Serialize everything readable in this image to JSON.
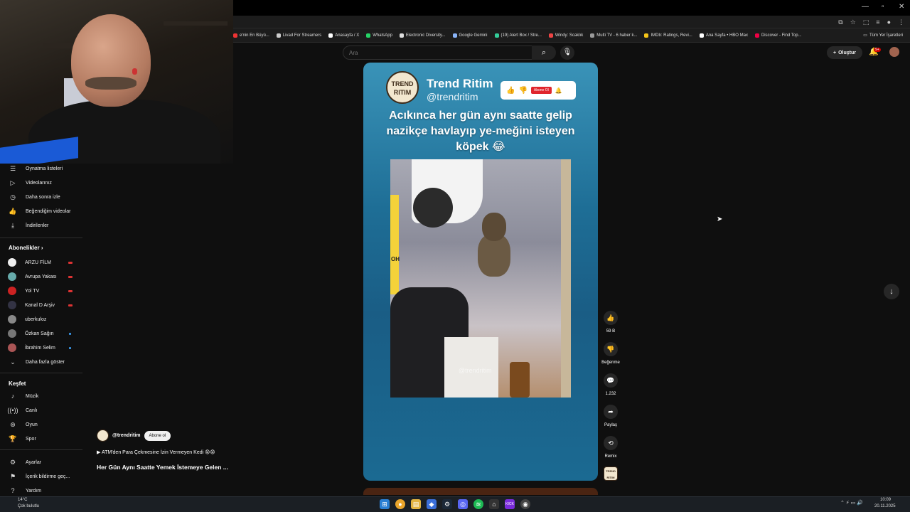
{
  "browser": {
    "bookmarks": [
      {
        "label": "e'nin En Büyü...",
        "color": "#e33"
      },
      {
        "label": "Livad For Streamers",
        "color": "#ccc"
      },
      {
        "label": "Anasayfa / X",
        "color": "#fff"
      },
      {
        "label": "WhatsApp",
        "color": "#25d366"
      },
      {
        "label": "Electronic Diversity...",
        "color": "#ddd"
      },
      {
        "label": "Google Gemini",
        "color": "#8ab4f8"
      },
      {
        "label": "(19) Alert Box / Stre...",
        "color": "#3c9"
      },
      {
        "label": "Windy: Scaklık",
        "color": "#e44"
      },
      {
        "label": "Multi TV - 6 haber k...",
        "color": "#999"
      },
      {
        "label": "IMDb: Ratings, Revi...",
        "color": "#f5c518"
      },
      {
        "label": "Ana Sayfa • HBO Max",
        "color": "#fff"
      },
      {
        "label": "Discover - Find Top...",
        "color": "#e04"
      }
    ],
    "all_bookmarks": "Tüm Yer İşaretleri"
  },
  "topbar": {
    "search_placeholder": "Ara",
    "create_label": "Oluştur",
    "notif_count": "9+"
  },
  "sidebar": {
    "items_top": [
      {
        "label": "Oynatma listeleri",
        "icon": "playlist-icon"
      },
      {
        "label": "Videolarınız",
        "icon": "video-icon"
      },
      {
        "label": "Daha sonra izle",
        "icon": "clock-icon"
      },
      {
        "label": "Beğendiğim videolar",
        "icon": "thumbs-up-icon"
      },
      {
        "label": "İndirilenler",
        "icon": "download-icon"
      }
    ],
    "subs_heading": "Abonelikler",
    "subscriptions": [
      {
        "label": "ARZU FİLM",
        "status": "live",
        "color": "#eee"
      },
      {
        "label": "Avrupa Yakası",
        "status": "live",
        "color": "#6aa"
      },
      {
        "label": "Yol TV",
        "status": "live",
        "color": "#c22"
      },
      {
        "label": "Kanal D Arşiv",
        "status": "live",
        "color": "#334"
      },
      {
        "label": "uberkuloz",
        "status": "",
        "color": "#888"
      },
      {
        "label": "Özkan Sağın",
        "status": "new",
        "color": "#777"
      },
      {
        "label": "İbrahim Selim",
        "status": "new",
        "color": "#a55"
      }
    ],
    "show_more": "Daha fazla göster",
    "explore_heading": "Keşfet",
    "explore": [
      {
        "label": "Müzik",
        "icon": "music-icon"
      },
      {
        "label": "Canlı",
        "icon": "live-icon"
      },
      {
        "label": "Oyun",
        "icon": "gamepad-icon"
      },
      {
        "label": "Spor",
        "icon": "trophy-icon"
      }
    ],
    "bottom": [
      {
        "label": "Ayarlar",
        "icon": "gear-icon"
      },
      {
        "label": "İçerik bildirme geç...",
        "icon": "flag-icon"
      },
      {
        "label": "Yardım",
        "icon": "help-icon"
      }
    ]
  },
  "short": {
    "channel_name": "Trend Ritim",
    "channel_handle": "@trendritim",
    "logo_text": "TREND RITIM",
    "subscribe_chip": "Abone Ol",
    "caption": "Acıkınca her gün aynı saatte gelip nazikçe havlayıp ye-meğini isteyen köpek 😂",
    "watermark": "@trendritim",
    "sign_text": "OH"
  },
  "actions": {
    "likes": "59 B",
    "dislike": "Beğenme",
    "comments": "1.232",
    "share": "Paylaş",
    "remix": "Remix"
  },
  "info": {
    "handle": "@trendritim",
    "subscribe": "Abone ol",
    "playlist": "▶ ATM'den Para Çekmesine İzin Vermeyen Kedi 😡😡",
    "title": "Her Gün Aynı Saatte Yemek İstemeye Gelen ..."
  },
  "taskbar": {
    "weather_temp": "14°C",
    "weather_desc": "Çok bulutlu",
    "time": "10:09",
    "date": "20.11.2025"
  }
}
